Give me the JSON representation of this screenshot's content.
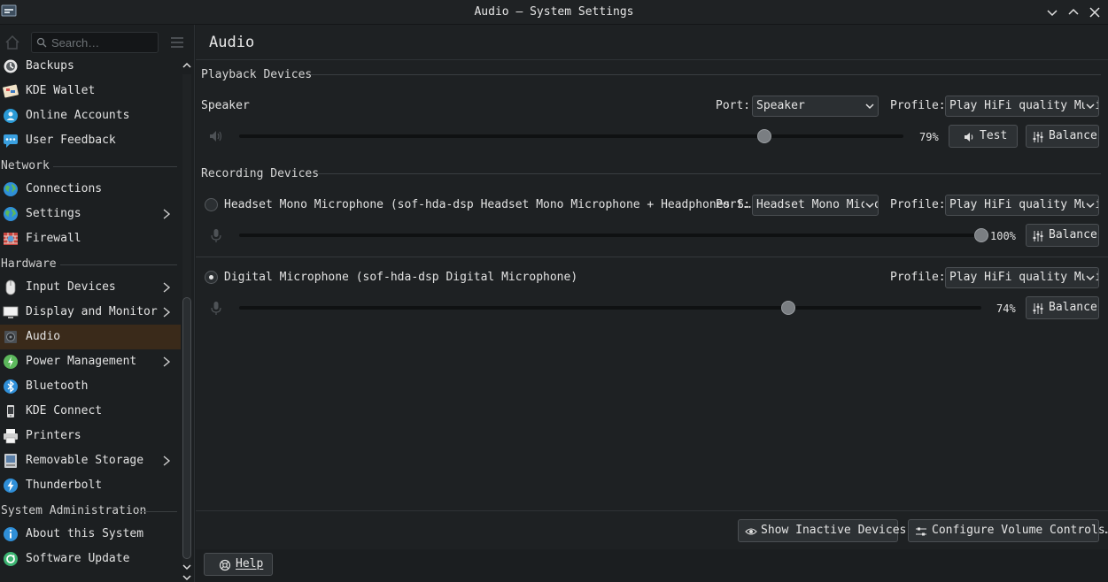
{
  "window": {
    "title": "Audio — System Settings"
  },
  "sidebar": {
    "search_placeholder": "Search…",
    "items": [
      {
        "label": "Backups",
        "icon": "backup-icon"
      },
      {
        "label": "KDE Wallet",
        "icon": "wallet-icon"
      },
      {
        "label": "Online Accounts",
        "icon": "online-accounts-icon"
      },
      {
        "label": "User Feedback",
        "icon": "feedback-icon"
      }
    ],
    "network_header": "Network",
    "network_items": [
      {
        "label": "Connections",
        "icon": "globe-icon"
      },
      {
        "label": "Settings",
        "icon": "globe-icon"
      },
      {
        "label": "Firewall",
        "icon": "firewall-icon"
      }
    ],
    "hardware_header": "Hardware",
    "hardware_items": [
      {
        "label": "Input Devices",
        "icon": "mouse-icon"
      },
      {
        "label": "Display and Monitor",
        "icon": "monitor-icon"
      },
      {
        "label": "Audio",
        "icon": "speaker-icon"
      },
      {
        "label": "Power Management",
        "icon": "power-icon"
      },
      {
        "label": "Bluetooth",
        "icon": "bluetooth-icon"
      },
      {
        "label": "KDE Connect",
        "icon": "phone-icon"
      },
      {
        "label": "Printers",
        "icon": "printer-icon"
      },
      {
        "label": "Removable Storage",
        "icon": "storage-icon"
      },
      {
        "label": "Thunderbolt",
        "icon": "thunderbolt-icon"
      }
    ],
    "sysadmin_header": "System Administration",
    "sysadmin_items": [
      {
        "label": "About this System",
        "icon": "info-icon"
      },
      {
        "label": "Software Update",
        "icon": "update-icon"
      }
    ]
  },
  "main": {
    "title": "Audio",
    "playback": {
      "section_title": "Playback Devices",
      "device_name": "Speaker",
      "port_label": "Port:",
      "port_value": "Speaker",
      "profile_label": "Profile:",
      "profile_value": "Play HiFi quality Music",
      "volume": 79,
      "volume_text": "79%",
      "test_label": "Test",
      "balance_label": "Balance"
    },
    "recording": {
      "section_title": "Recording Devices",
      "devices": [
        {
          "name": "Headset Mono Microphone (sof-hda-dsp Headset Mono Microphone + Headphones S…",
          "port_label": "Port:",
          "port_value": "Headset Mono Microphone",
          "profile_label": "Profile:",
          "profile_value": "Play HiFi quality Music",
          "volume": 100,
          "volume_text": "100%",
          "balance_label": "Balance",
          "default": false
        },
        {
          "name": "Digital Microphone (sof-hda-dsp Digital Microphone)",
          "profile_label": "Profile:",
          "profile_value": "Play HiFi quality Music",
          "volume": 74,
          "volume_text": "74%",
          "balance_label": "Balance",
          "default": true
        }
      ]
    },
    "footer": {
      "show_inactive_label": "Show Inactive Devices",
      "configure_label": "Configure Volume Controls…"
    }
  },
  "bottom": {
    "help_label": "Help"
  },
  "colors": {
    "active_item_bg": "#3a2a1a",
    "background": "#1e2123",
    "sidebar_bg": "#1c1f21"
  }
}
